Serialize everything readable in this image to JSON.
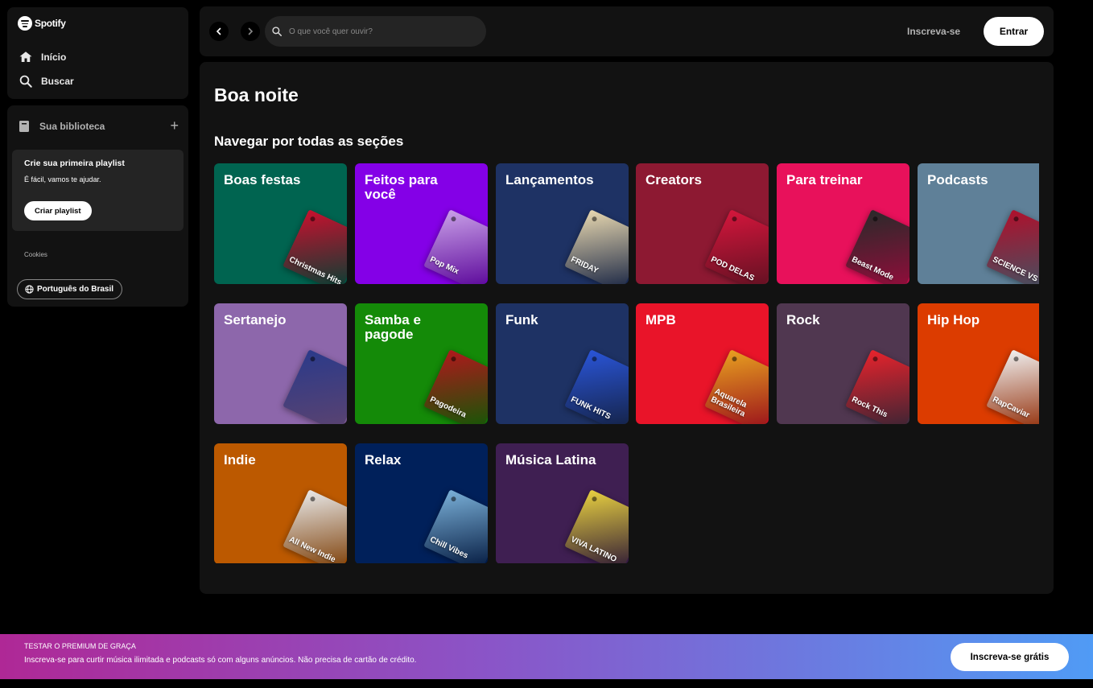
{
  "app": {
    "brand": "Spotify"
  },
  "sidebar": {
    "nav": [
      {
        "label": "Início",
        "icon": "home-icon"
      },
      {
        "label": "Buscar",
        "icon": "search-icon"
      }
    ],
    "library": {
      "title": "Sua biblioteca",
      "card": {
        "title": "Crie sua primeira playlist",
        "subtitle": "É fácil, vamos te ajudar.",
        "button": "Criar playlist"
      },
      "cookies": "Cookies",
      "language": "Português do Brasil"
    }
  },
  "topbar": {
    "search_placeholder": "O que você quer ouvir?",
    "signup": "Inscreva-se",
    "login": "Entrar"
  },
  "main": {
    "greeting": "Boa noite",
    "section_title": "Navegar por todas as seções",
    "tiles": [
      {
        "label": "Boas festas",
        "color": "#006450",
        "art_color": "#c8102e",
        "art_text": "Christmas Hits"
      },
      {
        "label": "Feitos para você",
        "color": "#8400e7",
        "art_color": "#c9a0e8",
        "art_text": "Pop Mix"
      },
      {
        "label": "Lançamentos",
        "color": "#1e3264",
        "art_color": "#e8d8b0",
        "art_text": "FRIDAY"
      },
      {
        "label": "Creators",
        "color": "#8d1932",
        "art_color": "#d4163c",
        "art_text": "POD DELAS"
      },
      {
        "label": "Para treinar",
        "color": "#e8115b",
        "art_color": "#2a2a2a",
        "art_text": "Beast Mode"
      },
      {
        "label": "Podcasts",
        "color": "#5f8098",
        "art_color": "#b0102c",
        "art_text": "SCIENCE VS"
      },
      {
        "label": "Sertanejo",
        "color": "#8d67ab",
        "art_color": "#2b3a8a",
        "art_text": ""
      },
      {
        "label": "Samba e pagode",
        "color": "#148a08",
        "art_color": "#b0181c",
        "art_text": "Pagodeira"
      },
      {
        "label": "Funk",
        "color": "#1e3264",
        "art_color": "#2a55d8",
        "art_text": "FUNK HITS"
      },
      {
        "label": "MPB",
        "color": "#e91429",
        "art_color": "#e8a020",
        "art_text": "Aquarela Brasileira"
      },
      {
        "label": "Rock",
        "color": "#503750",
        "art_color": "#e8232c",
        "art_text": "Rock This"
      },
      {
        "label": "Hip Hop",
        "color": "#dc3c00",
        "art_color": "#f0f0f0",
        "art_text": "RapCaviar"
      },
      {
        "label": "Indie",
        "color": "#bc5900",
        "art_color": "#e8e8e8",
        "art_text": "All New Indie"
      },
      {
        "label": "Relax",
        "color": "#00205a",
        "art_color": "#7ab0d8",
        "art_text": "Chill Vibes"
      },
      {
        "label": "Música Latina",
        "color": "#3f1f52",
        "art_color": "#e8d040",
        "art_text": "VIVA LATINO"
      }
    ]
  },
  "banner": {
    "small": "TESTAR O PREMIUM DE GRAÇA",
    "main": "Inscreva-se para curtir música ilimitada e podcasts só com alguns anúncios. Não precisa de cartão de crédito.",
    "button": "Inscreva-se grátis"
  }
}
